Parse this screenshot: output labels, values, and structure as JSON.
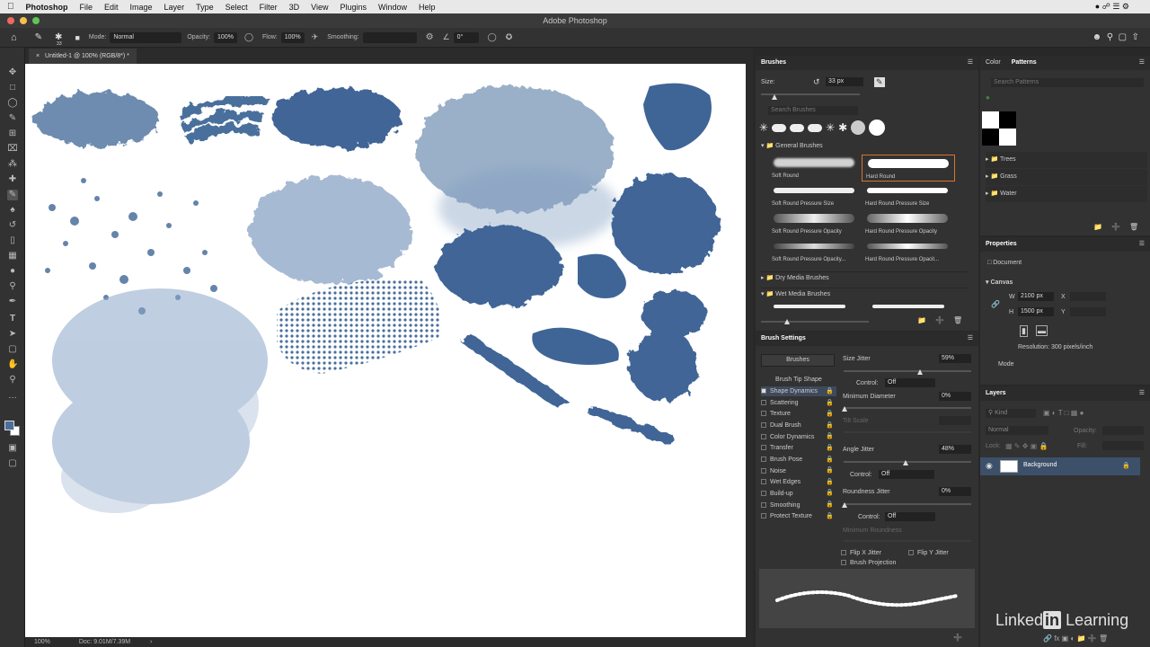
{
  "menubar": {
    "app": "Photoshop",
    "items": [
      "File",
      "Edit",
      "Image",
      "Layer",
      "Type",
      "Select",
      "Filter",
      "3D",
      "View",
      "Plugins",
      "Window",
      "Help"
    ],
    "datetime": "",
    "window_title": "Adobe Photoshop"
  },
  "options": {
    "brush_size": "33",
    "mode_label": "Mode:",
    "mode_value": "Normal",
    "opacity_label": "Opacity:",
    "opacity_value": "100%",
    "flow_label": "Flow:",
    "flow_value": "100%",
    "smoothing_label": "Smoothing:",
    "angle_value": "0°"
  },
  "document": {
    "tab": "Untitled-1 @ 100% (RGB/8*) *",
    "zoom": "100%",
    "doc_info": "Doc: 9.01M/7.39M"
  },
  "brushes_panel": {
    "tab": "Brushes",
    "size_label": "Size:",
    "size_value": "33 px",
    "search_placeholder": "Search Brushes",
    "group_general": "General Brushes",
    "brushes": [
      "Soft Round",
      "Hard Round",
      "Soft Round Pressure Size",
      "Hard Round Pressure Size",
      "Soft Round Pressure Opacity",
      "Hard Round Pressure Opacity",
      "Soft Round Pressure Opacity...",
      "Hard Round Pressure Opacit..."
    ],
    "group_dry": "Dry Media Brushes",
    "group_wet": "Wet Media Brushes"
  },
  "brush_settings": {
    "tab": "Brush Settings",
    "brushes_button": "Brushes",
    "items": [
      "Brush Tip Shape",
      "Shape Dynamics",
      "Scattering",
      "Texture",
      "Dual Brush",
      "Color Dynamics",
      "Transfer",
      "Brush Pose",
      "Noise",
      "Wet Edges",
      "Build-up",
      "Smoothing",
      "Protect Texture"
    ],
    "size_jitter_label": "Size Jitter",
    "size_jitter_value": "59%",
    "control_label": "Control:",
    "control_off": "Off",
    "min_diameter_label": "Minimum Diameter",
    "min_diameter_value": "0%",
    "tilt_scale_label": "Tilt Scale",
    "angle_jitter_label": "Angle Jitter",
    "angle_jitter_value": "48%",
    "roundness_jitter_label": "Roundness Jitter",
    "roundness_jitter_value": "0%",
    "min_roundness_label": "Minimum Roundness",
    "flip_x": "Flip X Jitter",
    "flip_y": "Flip Y Jitter",
    "brush_projection": "Brush Projection"
  },
  "patterns_panel": {
    "tab_color": "Color",
    "tab_patterns": "Patterns",
    "search_placeholder": "Search Patterns",
    "groups": [
      "Trees",
      "Grass",
      "Water"
    ]
  },
  "properties_panel": {
    "tab": "Properties",
    "document_label": "Document",
    "canvas_label": "Canvas",
    "w_label": "W",
    "w_value": "2100 px",
    "h_label": "H",
    "h_value": "1500 px",
    "x_label": "X",
    "y_label": "Y",
    "resolution": "Resolution: 300 pixels/inch",
    "mode_label": "Mode"
  },
  "layers_panel": {
    "tab": "Layers",
    "kind_label": "Kind",
    "blend_mode": "Normal",
    "opacity_label": "Opacity:",
    "lock_label": "Lock:",
    "fill_label": "Fill:",
    "layer_name": "Background"
  },
  "watermark": {
    "linked": "Linked",
    "in": "in",
    "learning": "Learning"
  },
  "colors": {
    "brush_blue": "#4a6f9c",
    "hard_round_highlight": "#d9742e"
  }
}
